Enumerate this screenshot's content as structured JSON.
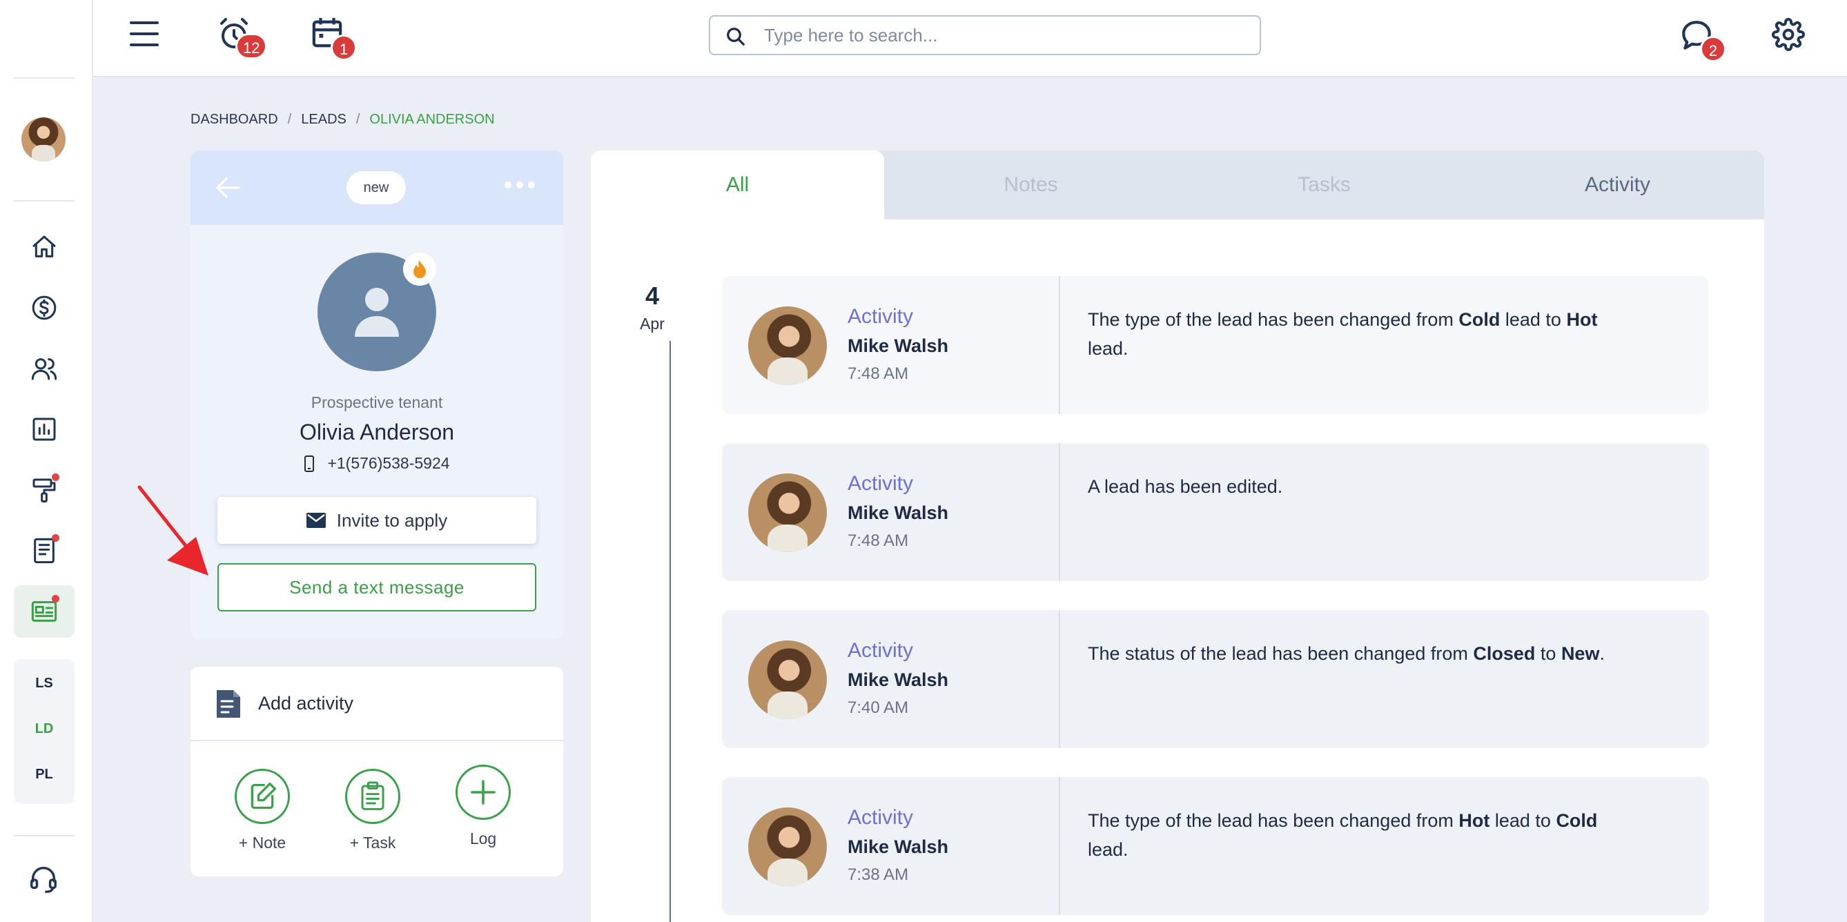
{
  "sidebar": {
    "nav": [
      {
        "name": "home-icon",
        "dot": false,
        "active": false
      },
      {
        "name": "dollar-icon",
        "dot": false,
        "active": false
      },
      {
        "name": "users-icon",
        "dot": false,
        "active": false
      },
      {
        "name": "chart-icon",
        "dot": false,
        "active": false
      },
      {
        "name": "paint-roller-icon",
        "dot": true,
        "active": false
      },
      {
        "name": "document-icon",
        "dot": true,
        "active": false
      },
      {
        "name": "leads-card-icon",
        "dot": true,
        "active": true
      }
    ],
    "sub_items": [
      "LS",
      "LD",
      "PL"
    ],
    "active_sub": "LD"
  },
  "topbar": {
    "alarm_count": "12",
    "calendar_count": "1",
    "chat_count": "2",
    "search_placeholder": "Type here to search..."
  },
  "breadcrumb": {
    "items": [
      "DASHBOARD",
      "LEADS"
    ],
    "current": "OLIVIA ANDERSON",
    "separator": "/"
  },
  "lead": {
    "status": "new",
    "type": "Prospective tenant",
    "name": "Olivia Anderson",
    "phone": "+1(576)538-5924",
    "invite_label": "Invite to apply",
    "text_label": "Send a text message"
  },
  "add_activity": {
    "title": "Add activity",
    "actions": [
      {
        "label": "+ Note",
        "icon": "note-icon"
      },
      {
        "label": "+ Task",
        "icon": "task-icon"
      },
      {
        "label": "Log",
        "icon": "plus-icon"
      }
    ]
  },
  "tabs": [
    "All",
    "Notes",
    "Tasks",
    "Activity"
  ],
  "active_tab": "All",
  "timeline": {
    "date_day": "4",
    "date_month": "Apr",
    "entries": [
      {
        "type": "Activity",
        "author": "Mike Walsh",
        "time": "7:48 AM",
        "parts": [
          [
            "The type of the lead has been changed from ",
            false
          ],
          [
            "Cold",
            true
          ],
          [
            " lead to ",
            false
          ],
          [
            "Hot",
            true
          ],
          [
            " lead.",
            false
          ]
        ]
      },
      {
        "type": "Activity",
        "author": "Mike Walsh",
        "time": "7:48 AM",
        "parts": [
          [
            "A lead has been edited.",
            false
          ]
        ]
      },
      {
        "type": "Activity",
        "author": "Mike Walsh",
        "time": "7:40 AM",
        "parts": [
          [
            "The status of the lead has been changed from ",
            false
          ],
          [
            "Closed",
            true
          ],
          [
            " to ",
            false
          ],
          [
            "New",
            true
          ],
          [
            ".",
            false
          ]
        ]
      },
      {
        "type": "Activity",
        "author": "Mike Walsh",
        "time": "7:38 AM",
        "parts": [
          [
            "The type of the lead has been changed from ",
            false
          ],
          [
            "Hot",
            true
          ],
          [
            " lead to ",
            false
          ],
          [
            "Cold",
            true
          ],
          [
            " lead.",
            false
          ]
        ]
      }
    ]
  },
  "colors": {
    "accent_green": "#39a043",
    "activity_purple": "#6f70d4",
    "badge_red": "#d93b3b"
  }
}
